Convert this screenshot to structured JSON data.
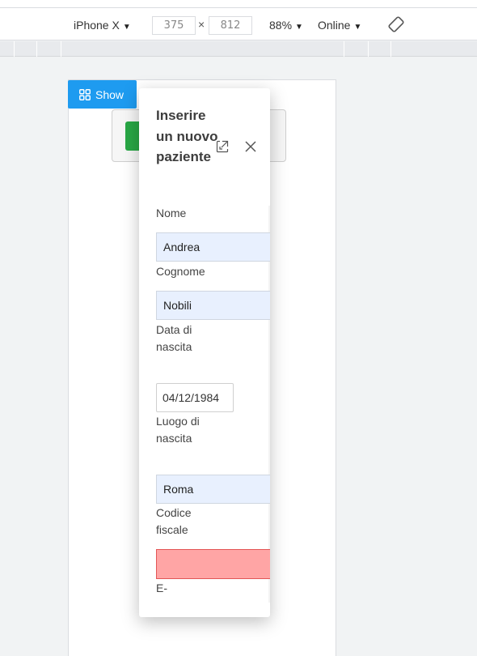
{
  "devtools": {
    "device": "iPhone X",
    "width": "375",
    "times": "×",
    "height": "812",
    "zoom": "88%",
    "network": "Online",
    "caret": "▼"
  },
  "page": {
    "show_button": "Show"
  },
  "modal": {
    "title": "Inserire un nuovo paziente",
    "fields": {
      "nome_label": "Nome",
      "nome_value": "Andrea",
      "cognome_label": "Cognome",
      "cognome_value": "Nobili",
      "data_label": "Data di nascita",
      "data_value": "04/12/1984",
      "luogo_label": "Luogo di nascita",
      "luogo_value": "Roma",
      "cf_label": "Codice fiscale",
      "cf_value": "",
      "email_label": "E-mail"
    }
  },
  "colors": {
    "show_button": "#1e9bf0",
    "error_field": "#ffa5a5",
    "autofill": "#e8f0fe"
  }
}
